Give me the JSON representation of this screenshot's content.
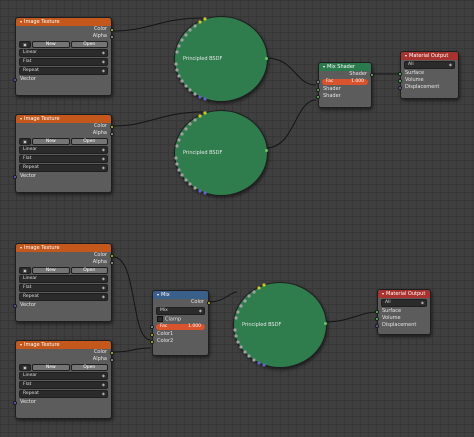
{
  "image_texture": {
    "title": "Image Texture",
    "out_color": "Color",
    "out_alpha": "Alpha",
    "new_label": "New",
    "open_label": "Open",
    "interpolation": "Linear",
    "projection": "Flat",
    "extension": "Repeat",
    "in_vector": "Vector"
  },
  "bsdf": {
    "title": "Principled BSDF"
  },
  "mix_shader": {
    "title": "Mix Shader",
    "out_shader": "Shader",
    "fac_label": "Fac",
    "fac_value": "1.000",
    "in_shader_1": "Shader",
    "in_shader_2": "Shader"
  },
  "material_output": {
    "title": "Material Output",
    "target": "All",
    "in_surface": "Surface",
    "in_volume": "Volume",
    "in_displacement": "Displacement"
  },
  "mix_rgb": {
    "title": "Mix",
    "out_color": "Color",
    "blend": "Mix",
    "clamp": "Clamp",
    "fac_label": "Fac",
    "fac_value": "1.000",
    "in_color1": "Color1",
    "in_color2": "Color2"
  },
  "colors": {
    "canvas": "#3f3f3f",
    "texture_header": "#c4581c",
    "shader_header": "#2a7a4e",
    "mix_header": "#3a5f8a",
    "output_header": "#a8322d",
    "bsdf_body": "#2f7d4d",
    "fac_slider": "#d9532c"
  }
}
